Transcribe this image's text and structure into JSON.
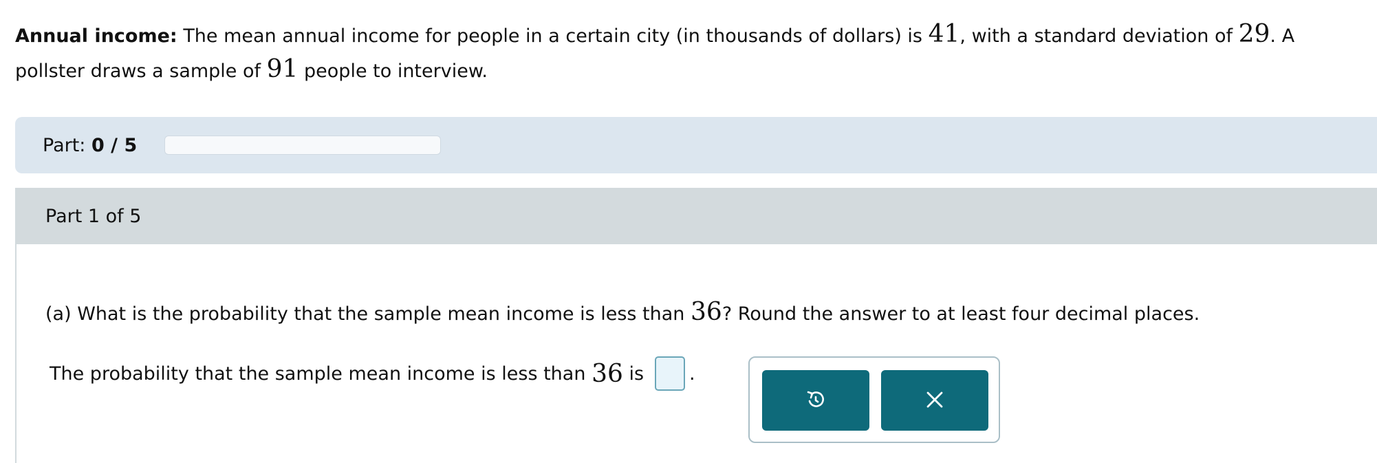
{
  "problem": {
    "title": "Annual income:",
    "text_1": "The mean annual income for people in a certain city (in thousands of dollars) is",
    "mean": "41",
    "text_2": ", with a standard deviation of",
    "sd": "29",
    "text_3": ". A pollster draws a sample of",
    "n": "91",
    "text_4": "people to interview."
  },
  "progress": {
    "label": "Part:",
    "value": "0 / 5",
    "fraction": 0
  },
  "part": {
    "header": "Part 1 of 5",
    "question_1": "(a) What is the probability that the sample mean income is less than",
    "question_value": "36",
    "question_2": "? Round the answer to at least four decimal places.",
    "answer_1": "The probability that the sample mean income is less than",
    "answer_value": "36",
    "answer_2": "is",
    "answer_end": ".",
    "answer_input_value": ""
  },
  "toolbar": {
    "undo_icon": "undo-icon",
    "clear_icon": "close-icon",
    "button_color": "#0e6a7a"
  }
}
